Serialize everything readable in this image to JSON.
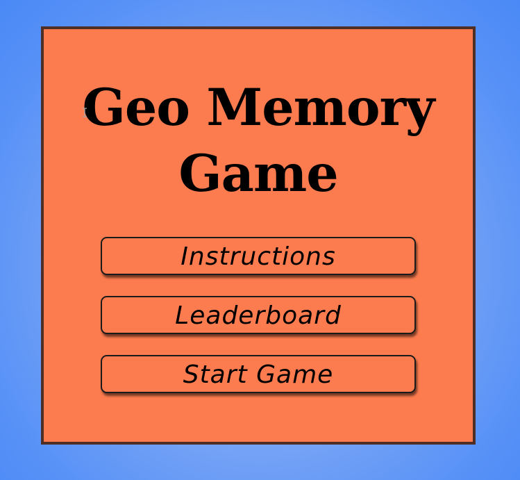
{
  "game": {
    "title_line1": "Geo Memory",
    "title_line2": "Game"
  },
  "menu": {
    "instructions_label": "Instructions",
    "leaderboard_label": "Leaderboard",
    "start_label": "Start Game"
  },
  "colors": {
    "background": "#4a89f6",
    "panel": "#fd7c4f",
    "panel_border": "#4f2e25",
    "button": "#fd7c4f",
    "text": "#000000"
  },
  "icons": {
    "cursor": "text-cursor-icon"
  }
}
